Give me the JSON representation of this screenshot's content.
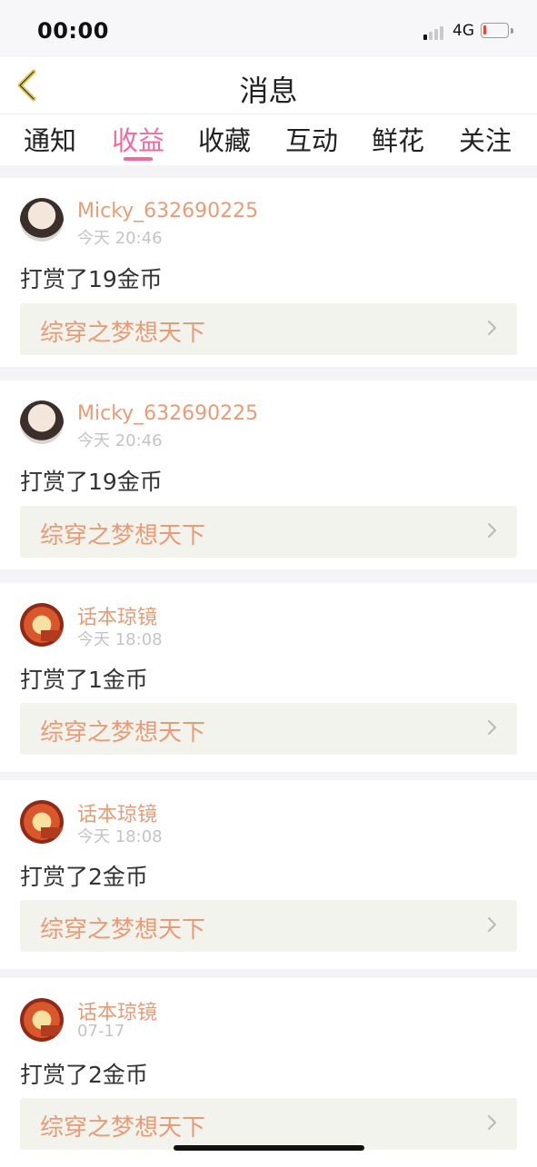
{
  "status_bar": {
    "time": "00:00",
    "network": "4G",
    "battery_level": 0.12,
    "battery_color": "#ff3b30"
  },
  "header": {
    "title": "消息",
    "back_icon": "chevron-left-icon"
  },
  "tabs": [
    {
      "label": "通知",
      "active": false
    },
    {
      "label": "收益",
      "active": true
    },
    {
      "label": "收藏",
      "active": false
    },
    {
      "label": "互动",
      "active": false
    },
    {
      "label": "鲜花",
      "active": false
    },
    {
      "label": "关注",
      "active": false
    }
  ],
  "colors": {
    "accent": "#f06aa0",
    "username": "#e99b75",
    "story_link": "#e99b75"
  },
  "messages": [
    {
      "username": "Micky_632690225",
      "time": "今天 20:46",
      "text": "打赏了19金币",
      "story": "综穿之梦想天下",
      "avatar": "girl-avatar"
    },
    {
      "username": "Micky_632690225",
      "time": "今天 20:46",
      "text": "打赏了19金币",
      "story": "综穿之梦想天下",
      "avatar": "girl-avatar"
    },
    {
      "username": "话本琼镜",
      "time": "今天 18:08",
      "text": "打赏了1金币",
      "story": "综穿之梦想天下",
      "avatar": "brand-avatar"
    },
    {
      "username": "话本琼镜",
      "time": "今天 18:08",
      "text": "打赏了2金币",
      "story": "综穿之梦想天下",
      "avatar": "brand-avatar"
    },
    {
      "username": "话本琼镜",
      "time": "07-17",
      "text": "打赏了2金币",
      "story": "综穿之梦想天下",
      "avatar": "brand-avatar"
    }
  ]
}
